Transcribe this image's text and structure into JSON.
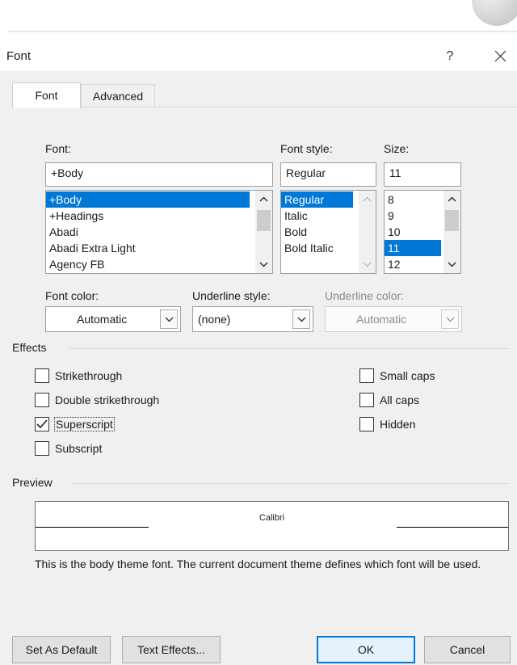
{
  "window": {
    "title": "Font",
    "help_label": "?"
  },
  "tabs": [
    {
      "label": "Font",
      "active": true
    },
    {
      "label": "Advanced",
      "active": false
    }
  ],
  "font": {
    "label": "Font:",
    "value": "+Body",
    "items": [
      "+Body",
      "+Headings",
      "Abadi",
      "Abadi Extra Light",
      "Agency FB"
    ],
    "selected": "+Body"
  },
  "font_style": {
    "label": "Font style:",
    "value": "Regular",
    "items": [
      "Regular",
      "Italic",
      "Bold",
      "Bold Italic"
    ],
    "selected": "Regular"
  },
  "size": {
    "label": "Size:",
    "value": "11",
    "items": [
      "8",
      "9",
      "10",
      "11",
      "12"
    ],
    "selected": "11"
  },
  "font_color": {
    "label": "Font color:",
    "value": "Automatic"
  },
  "underline_style": {
    "label": "Underline style:",
    "value": "(none)"
  },
  "underline_color": {
    "label": "Underline color:",
    "value": "Automatic",
    "disabled": true
  },
  "effects": {
    "label": "Effects",
    "items": [
      {
        "label": "Strikethrough",
        "checked": false
      },
      {
        "label": "Double strikethrough",
        "checked": false
      },
      {
        "label": "Superscript",
        "checked": true
      },
      {
        "label": "Subscript",
        "checked": false
      },
      {
        "label": "Small caps",
        "checked": false
      },
      {
        "label": "All caps",
        "checked": false
      },
      {
        "label": "Hidden",
        "checked": false
      }
    ]
  },
  "preview": {
    "label": "Preview",
    "sample_text": "Calibri",
    "description": "This is the body theme font. The current document theme defines which font will be used."
  },
  "buttons": {
    "set_default": "Set As Default",
    "text_effects": "Text Effects...",
    "ok": "OK",
    "cancel": "Cancel"
  },
  "colors": {
    "selection": "#0078d7",
    "dialog_bg": "#f0f0f0"
  }
}
